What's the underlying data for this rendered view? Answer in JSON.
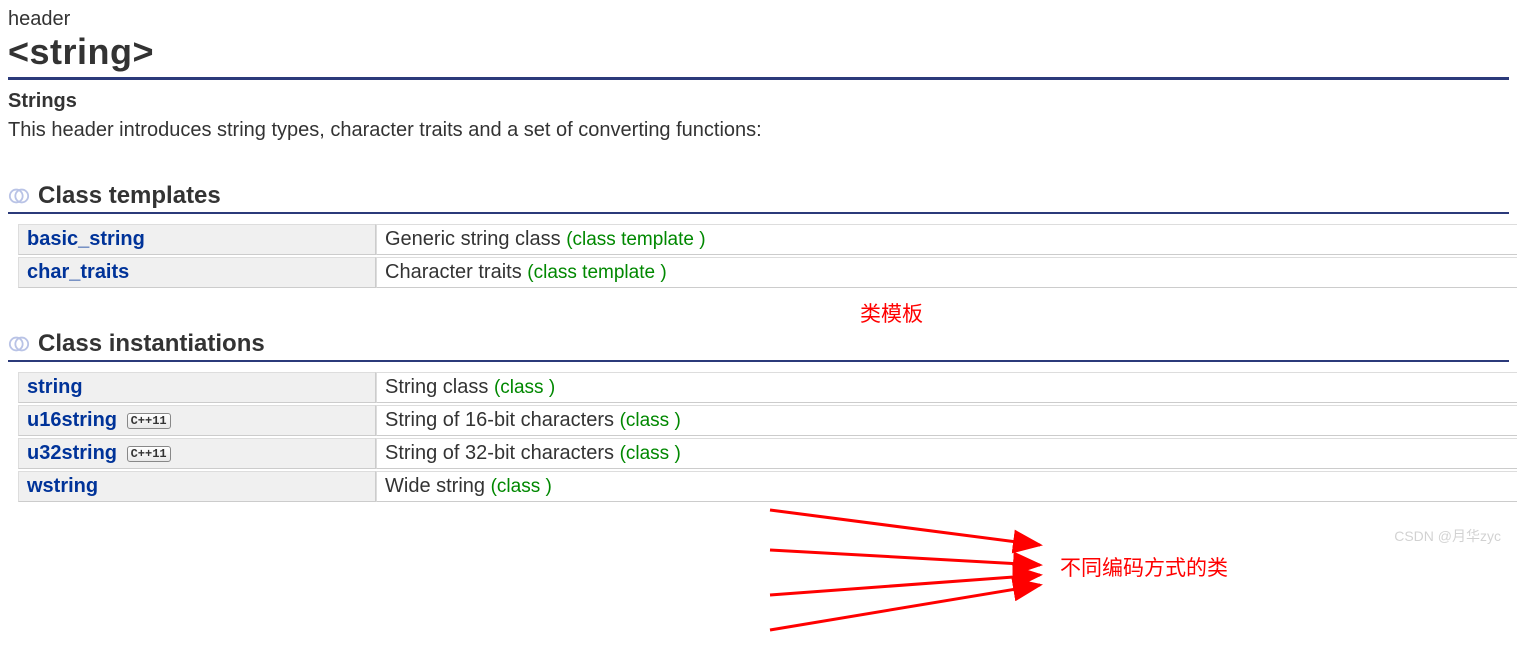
{
  "header": {
    "label": "header",
    "title": "<string>"
  },
  "sub": {
    "heading": "Strings",
    "intro": "This header introduces string types, character traits and a set of converting functions:"
  },
  "sections": {
    "templates": {
      "title": "Class templates",
      "rows": [
        {
          "name": "basic_string",
          "desc": "Generic string class",
          "tag": "(class template )",
          "cpp11": false
        },
        {
          "name": "char_traits",
          "desc": "Character traits",
          "tag": "(class template )",
          "cpp11": false
        }
      ]
    },
    "instantiations": {
      "title": "Class instantiations",
      "rows": [
        {
          "name": "string",
          "desc": "String class",
          "tag": "(class )",
          "cpp11": false
        },
        {
          "name": "u16string",
          "desc": "String of 16-bit characters",
          "tag": "(class )",
          "cpp11": true
        },
        {
          "name": "u32string",
          "desc": "String of 32-bit characters",
          "tag": "(class )",
          "cpp11": true
        },
        {
          "name": "wstring",
          "desc": "Wide string",
          "tag": "(class )",
          "cpp11": false
        }
      ]
    }
  },
  "annotations": {
    "a1": "类模板",
    "a2": "不同编码方式的类",
    "badge": "C++11"
  },
  "watermark": "CSDN @月华zyc"
}
